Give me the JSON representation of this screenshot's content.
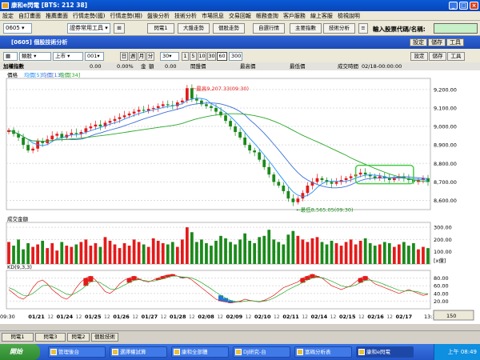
{
  "window": {
    "title": "康和e閃電 [BTS: 212 38]"
  },
  "menu": [
    "設定",
    "自訂畫面",
    "推薦畫面",
    "行情走勢(國)",
    "行情走勢(期)",
    "盤後分析",
    "技術分析",
    "市場訊息",
    "交易回報",
    "帳務查詢",
    "客戶服務",
    "線上客服",
    "檢視說明"
  ],
  "toolbar": {
    "code": "0605",
    "tools": "證券常用工具",
    "btn1": "閃電1",
    "btn2": "大盤走勢",
    "btn3": "個股走勢",
    "btn4": "自選行情",
    "btn5": "主要指數",
    "btn6": "技術分析",
    "search_label": "輸入股票代碼/名稱:"
  },
  "inner": {
    "title": "[0605] 個股技術分析",
    "btn_settings": "設定",
    "btn_save": "儲存",
    "btn_tools": "工具"
  },
  "controls": {
    "category": "類股",
    "market": "上市",
    "index_code": "001",
    "period_day": "日",
    "period_week": "週",
    "period_month": "月",
    "period_min": "分",
    "interval": "30",
    "m1": "1",
    "m5": "5",
    "m10": "10",
    "m30": "30",
    "m60": "60",
    "m_active": "60",
    "count": "300"
  },
  "info": {
    "name": "加權指數",
    "v1": "0.00",
    "v2": "0.00%",
    "l_amount": "金",
    "l_amount2": "額",
    "v3": "0.00",
    "l_open": "開盤價",
    "l_high": "最高價",
    "l_low": "最低價",
    "l_time": "成交時間",
    "time": "02/18-00:00:00"
  },
  "colors": {
    "up": "#e41a1a",
    "down": "#1a8a1a",
    "ma5": "#1e90ff",
    "ma13": "#3a6fd8",
    "ma34": "#28a828"
  },
  "chart_data": [
    {
      "type": "line",
      "title": "價格",
      "legend": [
        "均價[5]",
        "均價[13]",
        "均價[34]"
      ],
      "yticks": [
        8600,
        8700,
        8800,
        8900,
        9000,
        9100,
        9200
      ],
      "ylim": [
        8550,
        9260
      ],
      "annotations": [
        {
          "text": "最高9,207.33(09:30)",
          "value": 9207.33
        },
        {
          "text": "最低8,565.05(09:30)",
          "value": 8565.05
        }
      ],
      "closes": [
        8980,
        8960,
        8940,
        8900,
        8870,
        8880,
        8920,
        8910,
        8930,
        8950,
        8960,
        8940,
        8955,
        8965,
        8960,
        8970,
        8990,
        9000,
        9010,
        9000,
        9020,
        9030,
        9040,
        9050,
        9060,
        9070,
        9080,
        9090,
        9085,
        9095,
        9100,
        9110,
        9120,
        9115,
        9110,
        9130,
        9140,
        9207,
        9150,
        9140,
        9120,
        9110,
        9100,
        9080,
        9060,
        9030,
        9000,
        8970,
        8940,
        8900,
        8870,
        8860,
        8820,
        8780,
        8740,
        8700,
        8680,
        8650,
        8610,
        8590,
        8610,
        8640,
        8680,
        8700,
        8720,
        8710,
        8700,
        8690,
        8700,
        8710,
        8720,
        8730,
        8740,
        8750,
        8740,
        8730,
        8720,
        8730,
        8720,
        8710,
        8720,
        8730,
        8720,
        8710,
        8700,
        8710,
        8720,
        8700
      ]
    },
    {
      "type": "bar",
      "title": "成交金額",
      "yticks": [
        100,
        200,
        300
      ],
      "unit": "[x億]",
      "values": [
        180,
        150,
        200,
        120,
        170,
        140,
        160,
        190,
        130,
        170,
        110,
        180,
        150,
        140,
        160,
        180,
        200,
        150,
        170,
        140,
        220,
        190,
        160,
        130,
        170,
        150,
        200,
        180,
        160,
        140,
        210,
        190,
        170,
        160,
        180,
        140,
        200,
        300,
        260,
        180,
        200,
        170,
        150,
        190,
        230,
        210,
        180,
        160,
        200,
        250,
        190,
        170,
        220,
        230,
        280,
        200,
        180,
        160,
        240,
        270,
        230,
        200,
        180,
        210,
        220,
        180,
        160,
        190,
        170,
        150,
        180,
        200,
        160,
        190,
        210,
        170,
        150,
        160,
        180,
        170,
        140,
        160,
        180,
        150,
        170,
        120,
        140,
        130
      ]
    },
    {
      "type": "line",
      "title": "KD(9,3,3)",
      "yticks": [
        20,
        40,
        60,
        80
      ],
      "k": [
        50,
        40,
        30,
        25,
        35,
        55,
        70,
        75,
        65,
        50,
        40,
        30,
        25,
        35,
        55,
        70,
        80,
        85,
        75,
        60,
        45,
        40,
        50,
        65,
        75,
        80,
        85,
        78,
        72,
        70,
        75,
        80,
        85,
        88,
        90,
        85,
        80,
        82,
        75,
        65,
        55,
        45,
        35,
        25,
        20,
        18,
        15,
        17,
        20,
        25,
        22,
        20,
        18,
        22,
        28,
        35,
        45,
        55,
        60,
        65,
        70,
        80,
        85,
        90,
        85,
        80,
        70,
        60,
        55,
        50,
        55,
        60,
        70,
        80,
        85,
        75,
        65,
        60,
        55,
        50,
        45,
        40,
        45,
        50,
        45,
        40,
        35,
        38
      ],
      "d": [
        55,
        50,
        42,
        35,
        34,
        40,
        50,
        60,
        62,
        58,
        52,
        45,
        38,
        36,
        42,
        50,
        60,
        70,
        72,
        68,
        60,
        52,
        50,
        55,
        62,
        68,
        74,
        76,
        74,
        72,
        72,
        75,
        78,
        82,
        85,
        85,
        83,
        82,
        80,
        75,
        68,
        60,
        52,
        43,
        35,
        28,
        22,
        19,
        18,
        20,
        21,
        20,
        19,
        20,
        23,
        28,
        35,
        42,
        50,
        56,
        62,
        68,
        75,
        80,
        82,
        81,
        77,
        72,
        66,
        60,
        57,
        58,
        62,
        68,
        74,
        75,
        72,
        68,
        63,
        58,
        53,
        48,
        46,
        47,
        46,
        44,
        40,
        39
      ]
    }
  ],
  "xaxis": [
    "09:30",
    "01/21",
    "01/24",
    "01/25",
    "01/26",
    "01/27",
    "01/28",
    "02/08",
    "02/09",
    "02/10",
    "02/11",
    "02/14",
    "02/15",
    "02/16",
    "02/17",
    "13:30"
  ],
  "xaxis_minor": [
    "12",
    "12",
    "12",
    "12",
    "12",
    "12",
    "12",
    "12",
    "12",
    "12",
    "12",
    "12",
    "12"
  ],
  "counter": "150",
  "tabs": [
    "閃電1",
    "閃電3",
    "閃電2",
    "個股技術"
  ],
  "taskbar": {
    "start": "開始",
    "tasks": [
      "管理後台",
      "選擇權試算",
      "康和全部體",
      "DJ研究-台",
      "富碼分析表",
      "康和e閃電"
    ],
    "clock": "上午 08:49"
  }
}
